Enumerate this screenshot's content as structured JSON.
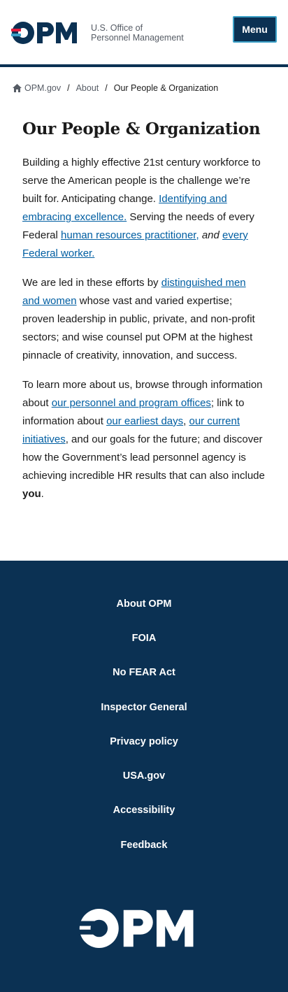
{
  "header": {
    "logo_text": "OPM",
    "agency_line1": "U.S. Office of",
    "agency_line2": "Personnel Management",
    "menu_label": "Menu"
  },
  "breadcrumb": {
    "home": "OPM.gov",
    "about": "About",
    "current": "Our People & Organization"
  },
  "page": {
    "title": "Our People & Organization",
    "p1": {
      "t1": "Building a highly effective 21st century workforce to serve the American people is the challenge we’re built for. Anticipating change. ",
      "link1": "Identifying and embracing excellence.",
      "t2": " Serving the needs of every Federal ",
      "link2": "human resources practitioner,",
      "t3": " ",
      "em": "and",
      "t4": " ",
      "link3": "every Federal worker."
    },
    "p2": {
      "t1": "We are led in these efforts by ",
      "link1": "distinguished men and women",
      "t2": " whose vast and varied expertise; proven leadership in public, private, and non-profit sectors; and wise counsel put OPM at the highest pinnacle of creativity, innovation, and success."
    },
    "p3": {
      "t1": "To learn more about us, browse through information about ",
      "link1": "our personnel and program offices",
      "t2": "; link to information about ",
      "link2": "our earliest days",
      "t3": ", ",
      "link3": "our current initiatives",
      "t4": ", and our goals for the future; and discover how the Government’s lead personnel agency is achieving incredible HR results that can also include ",
      "bold": "you",
      "t5": "."
    }
  },
  "footer": {
    "links": [
      "About OPM",
      "FOIA",
      "No FEAR Act",
      "Inspector General",
      "Privacy policy",
      "USA.gov",
      "Accessibility",
      "Feedback"
    ],
    "logo_text": "OPM"
  },
  "colors": {
    "navy": "#0b3153",
    "link": "#005ea2",
    "accent_red": "#e31c3d",
    "accent_blue": "#3ba0c7"
  }
}
